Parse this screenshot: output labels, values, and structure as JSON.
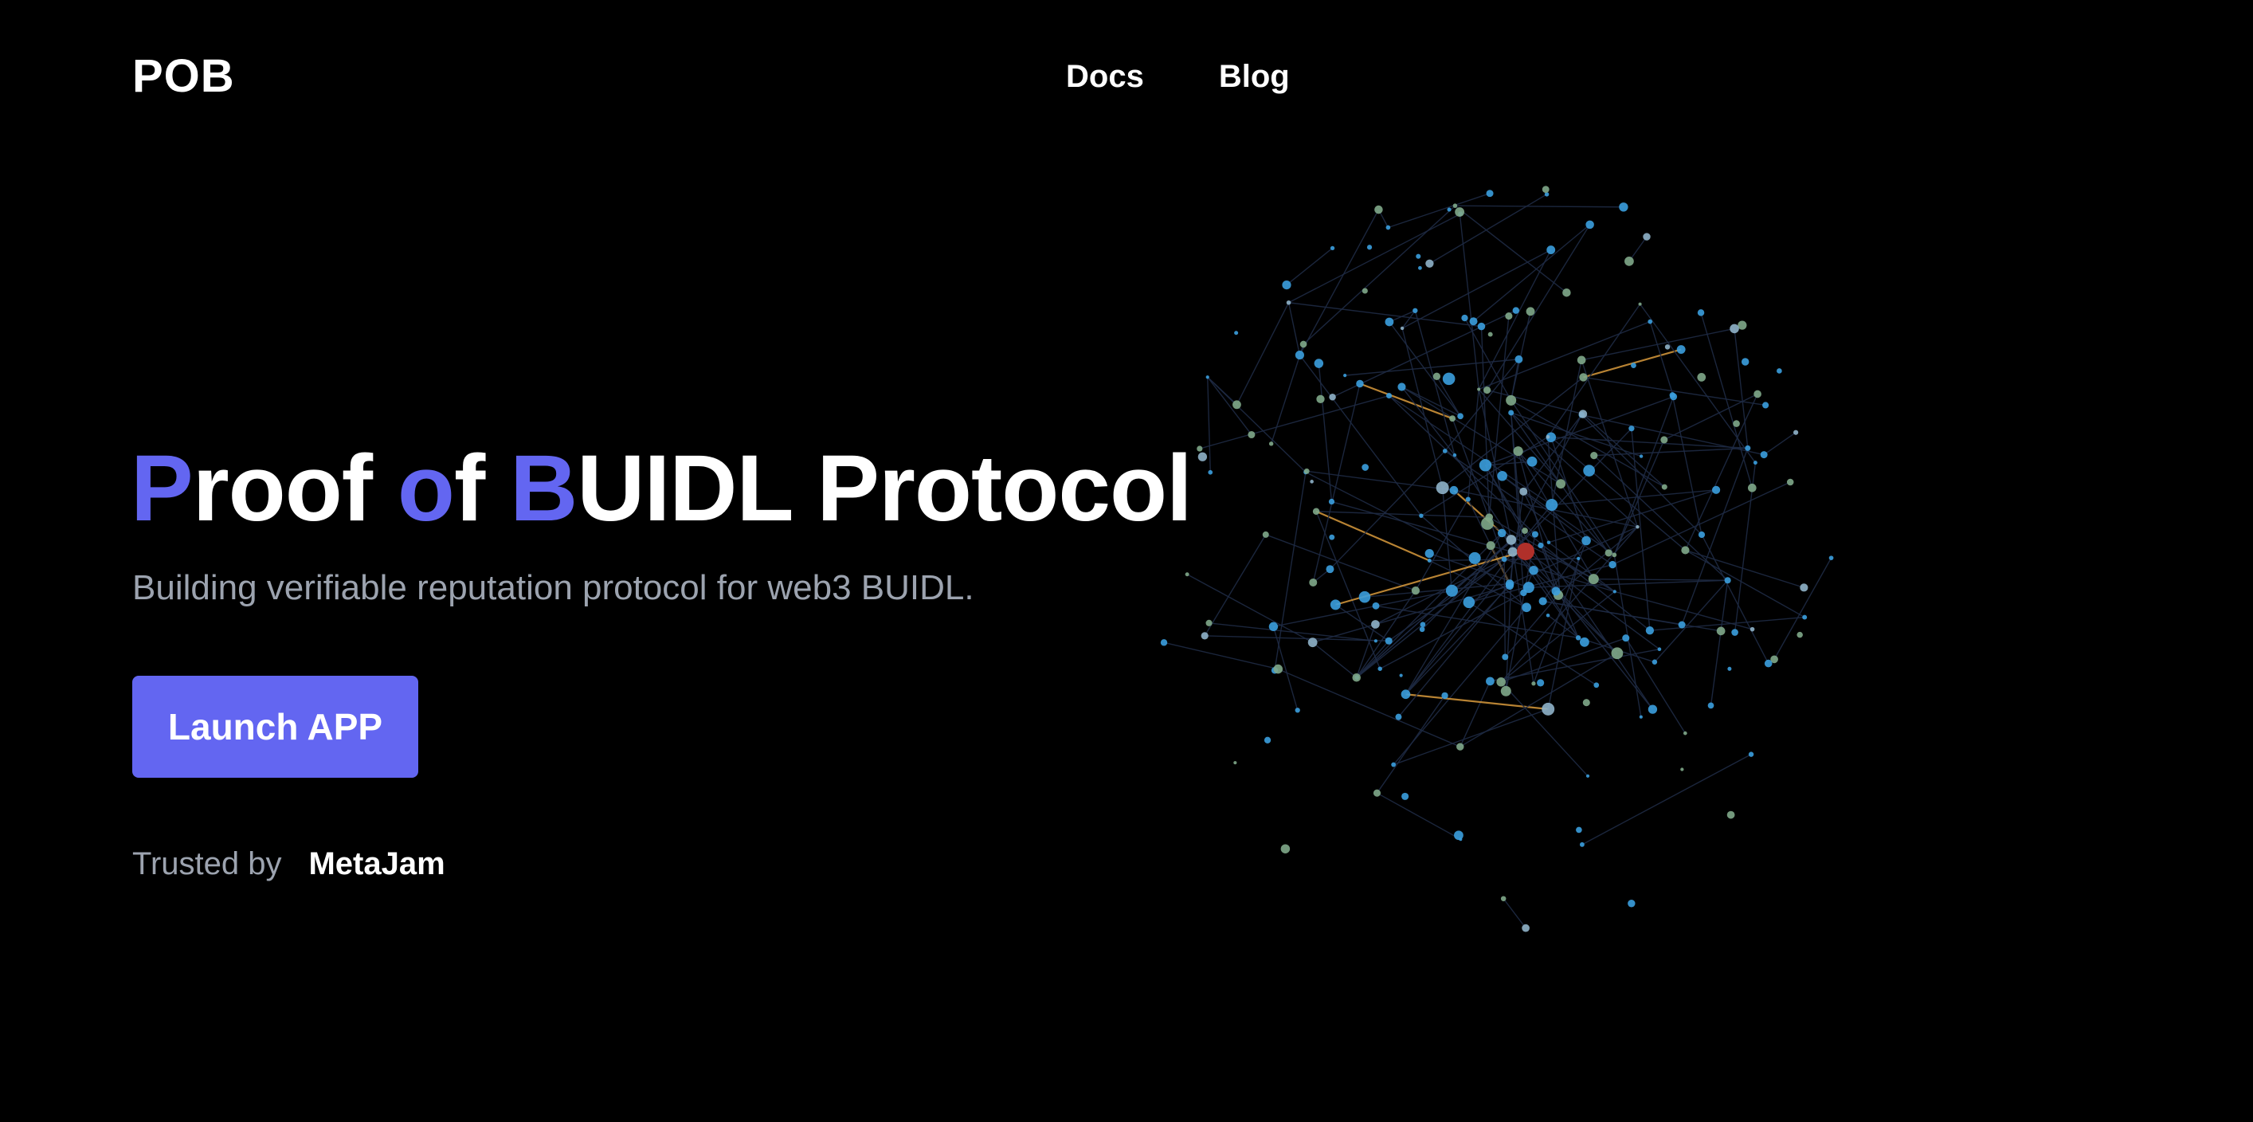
{
  "header": {
    "logo": "POB",
    "nav": [
      {
        "label": "Docs"
      },
      {
        "label": "Blog"
      }
    ]
  },
  "hero": {
    "title_parts": [
      {
        "text": "P",
        "style": "accent"
      },
      {
        "text": "roof ",
        "style": "plain"
      },
      {
        "text": "o",
        "style": "accent"
      },
      {
        "text": "f ",
        "style": "plain"
      },
      {
        "text": "B",
        "style": "accent"
      },
      {
        "text": "UIDL Protocol",
        "style": "plain"
      }
    ],
    "subtitle": "Building verifiable reputation protocol for web3 BUIDL.",
    "cta_label": "Launch APP"
  },
  "trusted": {
    "label": "Trusted by",
    "brand": "MetaJam"
  },
  "graph": {
    "icon": "network-graph-visualization"
  },
  "colors": {
    "background": "#000000",
    "accent": "#6366f1",
    "text": "#ffffff",
    "muted": "#9ca3af",
    "node_blue": "#3b9ede",
    "node_green": "#7fa88a",
    "node_red": "#b0302a",
    "edge": "#1e2a44",
    "edge_highlight": "#d89a3c"
  }
}
